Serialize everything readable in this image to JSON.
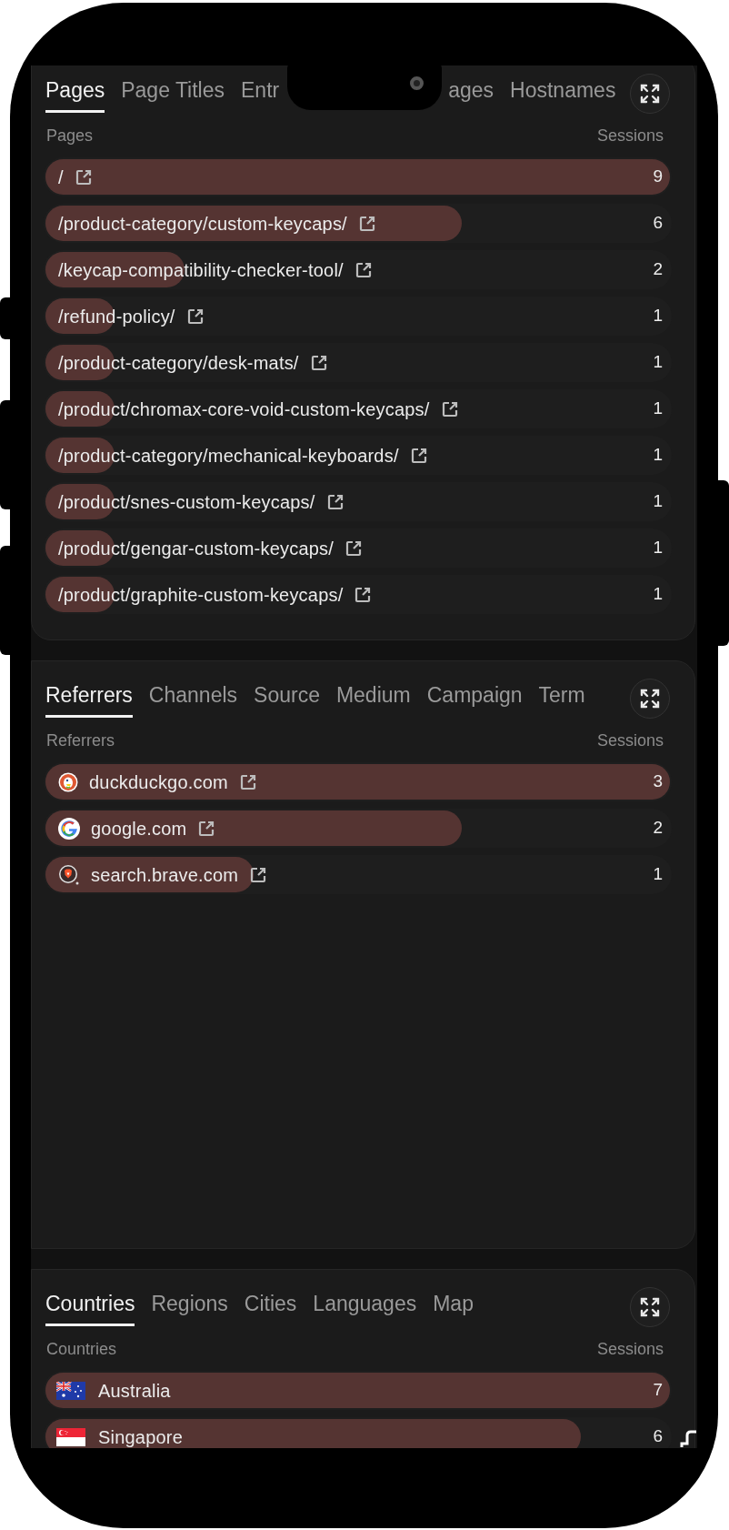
{
  "cards": [
    {
      "tabs": [
        {
          "label": "Pages",
          "selected": true
        },
        {
          "label": "Page Titles",
          "selected": false
        },
        {
          "label": "Entr",
          "selected": false
        },
        {
          "label": "ages",
          "selected": false
        },
        {
          "label": "Hostnames",
          "selected": false
        }
      ],
      "column_label": "Pages",
      "value_label": "Sessions",
      "rows": [
        {
          "kind": "page",
          "label": "/",
          "value": "9",
          "level": 1
        },
        {
          "kind": "page",
          "label": "/product-category/custom-keycaps/",
          "value": "6",
          "level": 0.667
        },
        {
          "kind": "page",
          "label": "/keycap-compatibility-checker-tool/",
          "value": "2",
          "level": 0.222
        },
        {
          "kind": "page",
          "label": "/refund-policy/",
          "value": "1",
          "level": 0.111
        },
        {
          "kind": "page",
          "label": "/product-category/desk-mats/",
          "value": "1",
          "level": 0.111
        },
        {
          "kind": "page",
          "label": "/product/chromax-core-void-custom-keycaps/",
          "value": "1",
          "level": 0.111
        },
        {
          "kind": "page",
          "label": "/product-category/mechanical-keyboards/",
          "value": "1",
          "level": 0.111
        },
        {
          "kind": "page",
          "label": "/product/snes-custom-keycaps/",
          "value": "1",
          "level": 0.111
        },
        {
          "kind": "page",
          "label": "/product/gengar-custom-keycaps/",
          "value": "1",
          "level": 0.111
        },
        {
          "kind": "page",
          "label": "/product/graphite-custom-keycaps/",
          "value": "1",
          "level": 0.111
        }
      ]
    },
    {
      "tabs": [
        {
          "label": "Referrers",
          "selected": true
        },
        {
          "label": "Channels",
          "selected": false
        },
        {
          "label": "Source",
          "selected": false
        },
        {
          "label": "Medium",
          "selected": false
        },
        {
          "label": "Campaign",
          "selected": false
        },
        {
          "label": "Term",
          "selected": false
        }
      ],
      "column_label": "Referrers",
      "value_label": "Sessions",
      "rows": [
        {
          "kind": "referrer",
          "label": "duckduckgo.com",
          "value": "3",
          "level": 1
        },
        {
          "kind": "referrer",
          "label": "google.com",
          "value": "2",
          "level": 0.667
        },
        {
          "kind": "referrer",
          "label": "search.brave.com",
          "value": "1",
          "level": 0.333
        }
      ]
    },
    {
      "tabs": [
        {
          "label": "Countries",
          "selected": true
        },
        {
          "label": "Regions",
          "selected": false
        },
        {
          "label": "Cities",
          "selected": false
        },
        {
          "label": "Languages",
          "selected": false
        },
        {
          "label": "Map",
          "selected": false
        }
      ],
      "column_label": "Countries",
      "value_label": "Sessions",
      "rows": [
        {
          "kind": "country",
          "label": "Australia",
          "value": "7",
          "level": 1
        },
        {
          "kind": "country",
          "label": "Singapore",
          "value": "6",
          "level": 0.857
        }
      ]
    }
  ]
}
